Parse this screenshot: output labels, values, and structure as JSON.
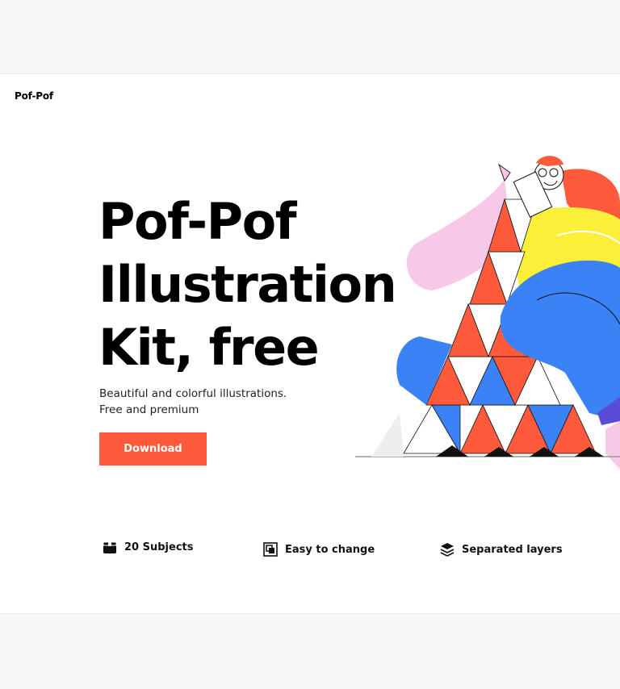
{
  "header": {
    "logo": "Pof-Pof"
  },
  "hero": {
    "title_lines": [
      "Pof-Pof",
      "Illustration",
      "Kit, free"
    ],
    "subtitle_lines": [
      "Beautiful and colorful illustrations.",
      "Free and premium"
    ],
    "download_label": "Download"
  },
  "features": [
    {
      "label": "20 Subjects",
      "icon": "box-icon"
    },
    {
      "label": "Easy to change",
      "icon": "edit-frame-icon"
    },
    {
      "label": "Separated layers",
      "icon": "layers-icon"
    }
  ],
  "colors": {
    "accent": "#ff5a3c",
    "blue": "#3b82f6",
    "yellow": "#fbef3a",
    "pink": "#f8c8e8",
    "background": "#f7f7f7"
  }
}
